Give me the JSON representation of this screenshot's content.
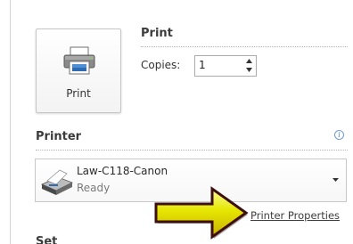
{
  "print_button": {
    "label": "Print",
    "icon": "printer-icon"
  },
  "print_section": {
    "title": "Print"
  },
  "copies": {
    "label": "Copies:",
    "value": "1"
  },
  "printer_section": {
    "title": "Printer",
    "info_glyph": "i"
  },
  "selected_printer": {
    "name": "Law-C118-Canon",
    "status": "Ready",
    "icon": "printer-device-icon"
  },
  "printer_properties_link": "Printer Properties",
  "annotation": {
    "type": "arrow",
    "color": "#e6e600",
    "outline": "#3d0f0f"
  },
  "settings_section_partial": {
    "title": "Set"
  },
  "colors": {
    "accent": "#4d7fc0",
    "border": "#c8c8c8"
  }
}
